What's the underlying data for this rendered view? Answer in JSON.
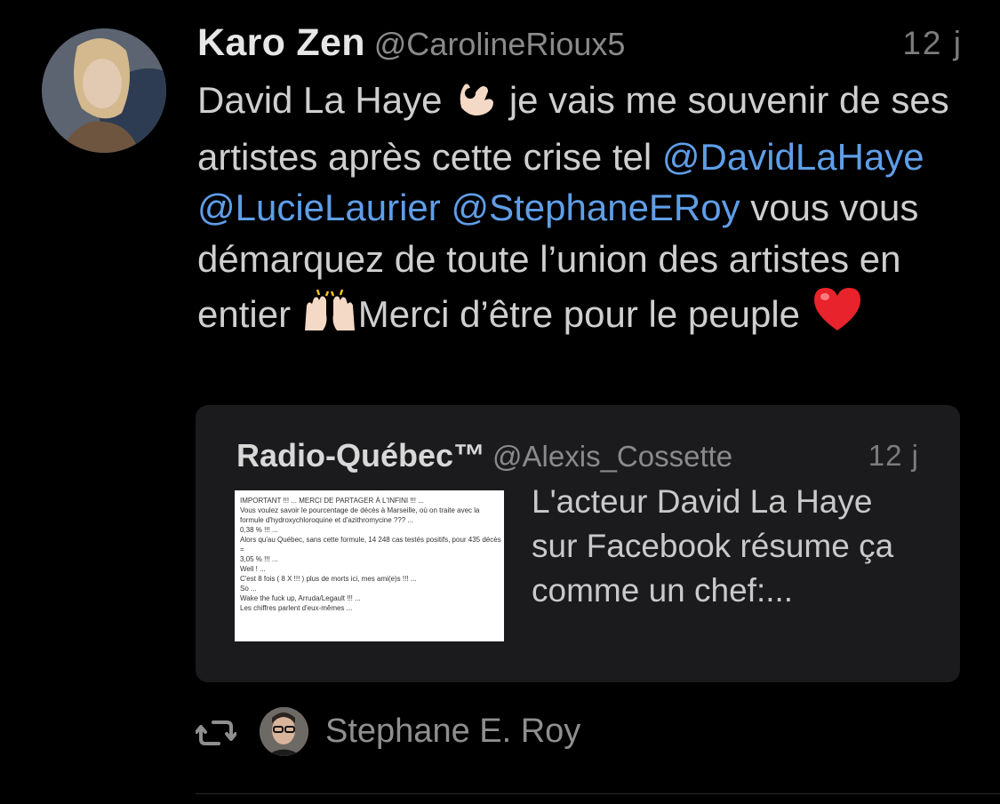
{
  "tweet": {
    "author_name": "Karo Zen",
    "author_handle": "@CarolineRioux5",
    "time": "12 j",
    "text_part1": "David La Haye ",
    "text_part2": " je vais me souvenir de ses artistes après cette crise tel ",
    "mention1": "@DavidLaHaye",
    "mention2": "@LucieLaurier",
    "mention3": "@StephaneERoy",
    "text_part3": " vous vous démarquez de toute l’union des artistes en entier ",
    "text_part4": "Merci d’être pour le peuple ",
    "emojis": [
      "ok-hand-icon",
      "raising-hands-icon",
      "red-heart-icon"
    ]
  },
  "quoted": {
    "name": "Radio-Québec™",
    "handle": "@Alexis_Cossette",
    "time": "12 j",
    "text": "L'acteur David La Haye sur Facebook résume ça comme un chef:...",
    "thumbnail_lines": [
      "IMPORTANT !!! ... MERCI DE PARTAGER À L'INFINI !!! ...",
      "Vous voulez savoir le pourcentage de décès à Marseille, où on traite avec la formule d'hydroxychloroquine et d'azithromycine ??? ...",
      "0,38 % !!! ...",
      "Alors qu'au Québec, sans cette formule, 14 248 cas testés positifs, pour 435 décès =",
      "3,05 % !!! ...",
      "Well ! ...",
      "C'est 8 fois ( 8 X !!! ) plus de morts ici, mes ami(e)s !!! ...",
      "So ...",
      "Wake the fuck up, Arruda/Legault !!! ...",
      "Les chiffres parlent d'eux-mêmes ..."
    ]
  },
  "footer": {
    "retweeted_by": "Stephane E. Roy"
  },
  "colors": {
    "background": "#000000",
    "mention": "#5f9ee8",
    "quote_bg": "#1b1b1d"
  }
}
